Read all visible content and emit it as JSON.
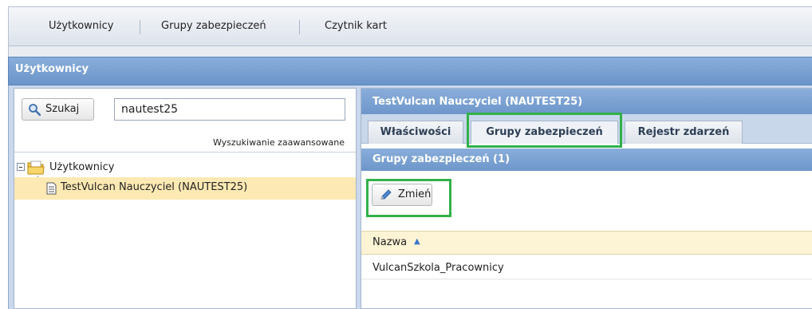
{
  "topmenu": {
    "tabs": [
      {
        "label": "Użytkownicy"
      },
      {
        "label": "Grupy zabezpieczeń"
      },
      {
        "label": "Czytnik kart"
      }
    ]
  },
  "main": {
    "title": "Użytkownicy"
  },
  "left": {
    "search_label": "Szukaj",
    "search_value": "nautest25",
    "advanced_link": "Wyszukiwanie zaawansowane",
    "tree": {
      "root_label": "Użytkownicy",
      "items": [
        {
          "label": "TestVulcan Nauczyciel (NAUTEST25)"
        }
      ]
    }
  },
  "right": {
    "title": "TestVulcan Nauczyciel (NAUTEST25)",
    "tabs": [
      {
        "label": "Właściwości"
      },
      {
        "label": "Grupy zabezpieczeń",
        "active": true
      },
      {
        "label": "Rejestr zdarzeń"
      }
    ],
    "section_title": "Grupy zabezpieczeń (1)",
    "edit_label": "Zmień",
    "grid": {
      "columns": [
        {
          "label": "Nazwa",
          "sort": "ascending"
        }
      ],
      "rows": [
        [
          "VulcanSzkola_Pracownicy"
        ]
      ]
    }
  },
  "colors": {
    "header_blue": "#7aa1d2",
    "highlight_green": "#33b04a",
    "selected_row": "#fde9b3",
    "grid_header": "#fdf3d5"
  },
  "icons": [
    "search-icon",
    "folder-icon",
    "document-icon",
    "pencil-icon",
    "sort-ascending-icon",
    "tree-collapse-icon"
  ]
}
